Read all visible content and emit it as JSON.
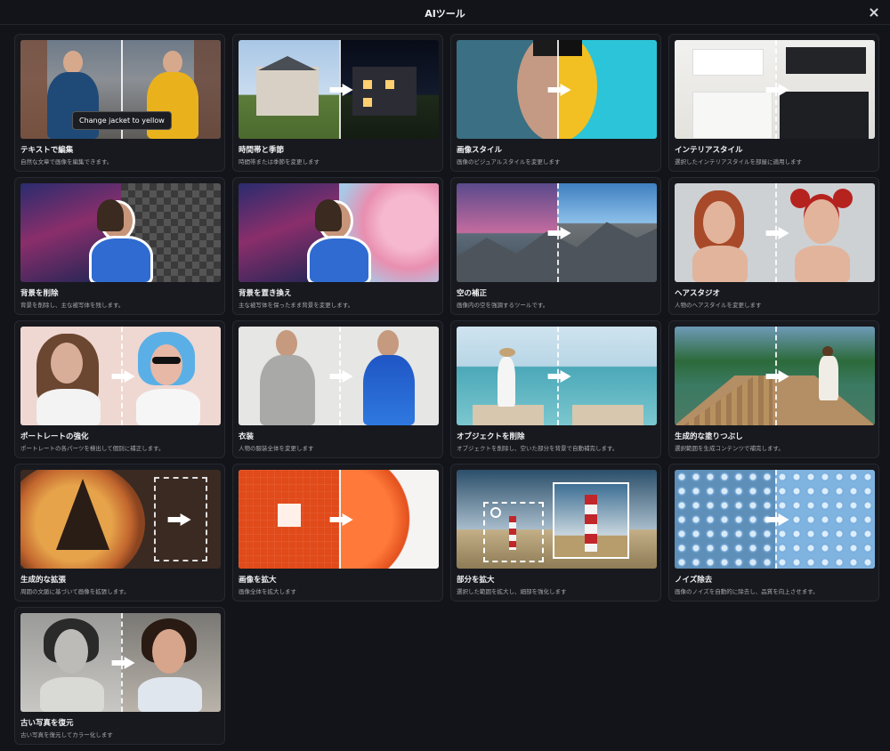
{
  "dialog": {
    "title": "AIツール",
    "close_icon": "close-icon"
  },
  "tools": [
    {
      "id": "text-edit",
      "title": "テキストで編集",
      "description": "自然な文章で画像を編集できます。",
      "tooltip": "Change jacket to yellow"
    },
    {
      "id": "time-season",
      "title": "時間帯と季節",
      "description": "時間帯または季節を変更します"
    },
    {
      "id": "image-style",
      "title": "画像スタイル",
      "description": "画像のビジュアルスタイルを変更します"
    },
    {
      "id": "interior-style",
      "title": "インテリアスタイル",
      "description": "選択したインテリアスタイルを部屋に適用します"
    },
    {
      "id": "remove-bg",
      "title": "背景を削除",
      "description": "背景を削除し、主な被写体を残します。"
    },
    {
      "id": "replace-bg",
      "title": "背景を置き換え",
      "description": "主な被写体を保ったまま背景を変更します。"
    },
    {
      "id": "sky-fix",
      "title": "空の補正",
      "description": "画像内の空を強調するツールです。"
    },
    {
      "id": "hair-studio",
      "title": "ヘアスタジオ",
      "description": "人物のヘアスタイルを変更します"
    },
    {
      "id": "portrait-enhance",
      "title": "ポートレートの強化",
      "description": "ポートレートの各パーツを検出して個別に補正します。"
    },
    {
      "id": "outfit",
      "title": "衣装",
      "description": "人物の服装全体を変更します"
    },
    {
      "id": "object-remove",
      "title": "オブジェクトを削除",
      "description": "オブジェクトを削除し、空いた部分を背景で自動補完します。"
    },
    {
      "id": "gen-fill",
      "title": "生成的な塗りつぶし",
      "description": "選択範囲を生成コンテンツで補完します。"
    },
    {
      "id": "gen-expand",
      "title": "生成的な拡張",
      "description": "周囲の文脈に基づいて画像を拡張します。"
    },
    {
      "id": "upscale",
      "title": "画像を拡大",
      "description": "画像全体を拡大します"
    },
    {
      "id": "zoom-part",
      "title": "部分を拡大",
      "description": "選択した範囲を拡大し、細部を強化します"
    },
    {
      "id": "denoise",
      "title": "ノイズ除去",
      "description": "画像のノイズを自動的に除去し、品質を向上させます。"
    },
    {
      "id": "restore-photo",
      "title": "古い写真を復元",
      "description": "古い写真を復元してカラー化します"
    }
  ]
}
